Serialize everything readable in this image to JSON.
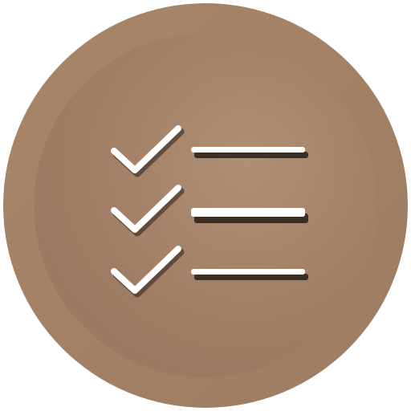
{
  "icon": {
    "name": "checklist-icon",
    "rows": [
      {
        "checked": true
      },
      {
        "checked": true
      },
      {
        "checked": true
      }
    ]
  },
  "colors": {
    "outer_ring": "#A58369",
    "inner_disc": "#A07E66",
    "highlight": "#B09377",
    "mark": "#FFFFFF",
    "shadow": "#2A1E16"
  }
}
